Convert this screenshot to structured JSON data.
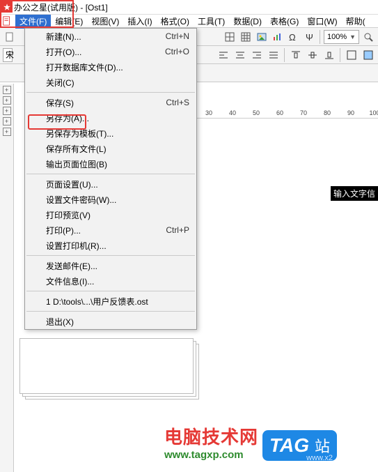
{
  "titlebar": {
    "app_name": "办公之星",
    "edition": "(试用版)",
    "doc": "- [Ost1]"
  },
  "menubar": {
    "items": [
      {
        "label": "文件(F)"
      },
      {
        "label": "编辑(E)"
      },
      {
        "label": "视图(V)"
      },
      {
        "label": "插入(I)"
      },
      {
        "label": "格式(O)"
      },
      {
        "label": "工具(T)"
      },
      {
        "label": "数据(D)"
      },
      {
        "label": "表格(G)"
      },
      {
        "label": "窗口(W)"
      },
      {
        "label": "帮助("
      }
    ]
  },
  "toolbar": {
    "icons": [
      "new-icon",
      "open-icon",
      "save-icon",
      "print-icon",
      "preview-icon",
      "table-icon",
      "image-icon",
      "chart-icon",
      "omega-icon",
      "psi-icon"
    ],
    "zoom": "100%"
  },
  "toolbar2": {
    "font_label": "宋",
    "align_icons": [
      "align-left-icon",
      "align-center-icon",
      "align-right-icon",
      "align-justify-icon",
      "align-top-icon",
      "align-middle-icon",
      "align-bottom-icon",
      "list-bullets-icon",
      "list-numbers-icon",
      "indent-left-icon",
      "indent-right-icon",
      "borders-icon"
    ]
  },
  "dropdown": {
    "items": [
      {
        "label": "新建(N)...",
        "shortcut": "Ctrl+N"
      },
      {
        "label": "打开(O)...",
        "shortcut": "Ctrl+O"
      },
      {
        "label": "打开数据库文件(D)...",
        "shortcut": ""
      },
      {
        "label": "关闭(C)",
        "shortcut": ""
      },
      {
        "div": true
      },
      {
        "label": "保存(S)",
        "shortcut": "Ctrl+S"
      },
      {
        "label": "另存为(A)...",
        "shortcut": ""
      },
      {
        "label": "另保存为模板(T)...",
        "shortcut": ""
      },
      {
        "label": "保存所有文件(L)",
        "shortcut": ""
      },
      {
        "label": "输出页面位图(B)",
        "shortcut": ""
      },
      {
        "div": true
      },
      {
        "label": "页面设置(U)...",
        "shortcut": ""
      },
      {
        "label": "设置文件密码(W)...",
        "shortcut": ""
      },
      {
        "label": "打印预览(V)",
        "shortcut": ""
      },
      {
        "label": "打印(P)...",
        "shortcut": "Ctrl+P"
      },
      {
        "label": "设置打印机(R)...",
        "shortcut": ""
      },
      {
        "div": true
      },
      {
        "label": "发送邮件(E)...",
        "shortcut": ""
      },
      {
        "label": "文件信息(I)...",
        "shortcut": ""
      },
      {
        "div": true
      },
      {
        "label": "1 D:\\tools\\...\\用户反馈表.ost",
        "shortcut": ""
      },
      {
        "div": true
      },
      {
        "label": "退出(X)",
        "shortcut": ""
      }
    ]
  },
  "ruler": {
    "ticks": [
      "30",
      "40",
      "50",
      "60",
      "70",
      "80",
      "90",
      "100"
    ]
  },
  "editor": {
    "placeholder": "输入文字信"
  },
  "watermark": {
    "line1": "电脑技术网",
    "line2": "www.tagxp.com",
    "badge_big": "TAG",
    "badge_zh": "站",
    "url2": "www.x2"
  }
}
